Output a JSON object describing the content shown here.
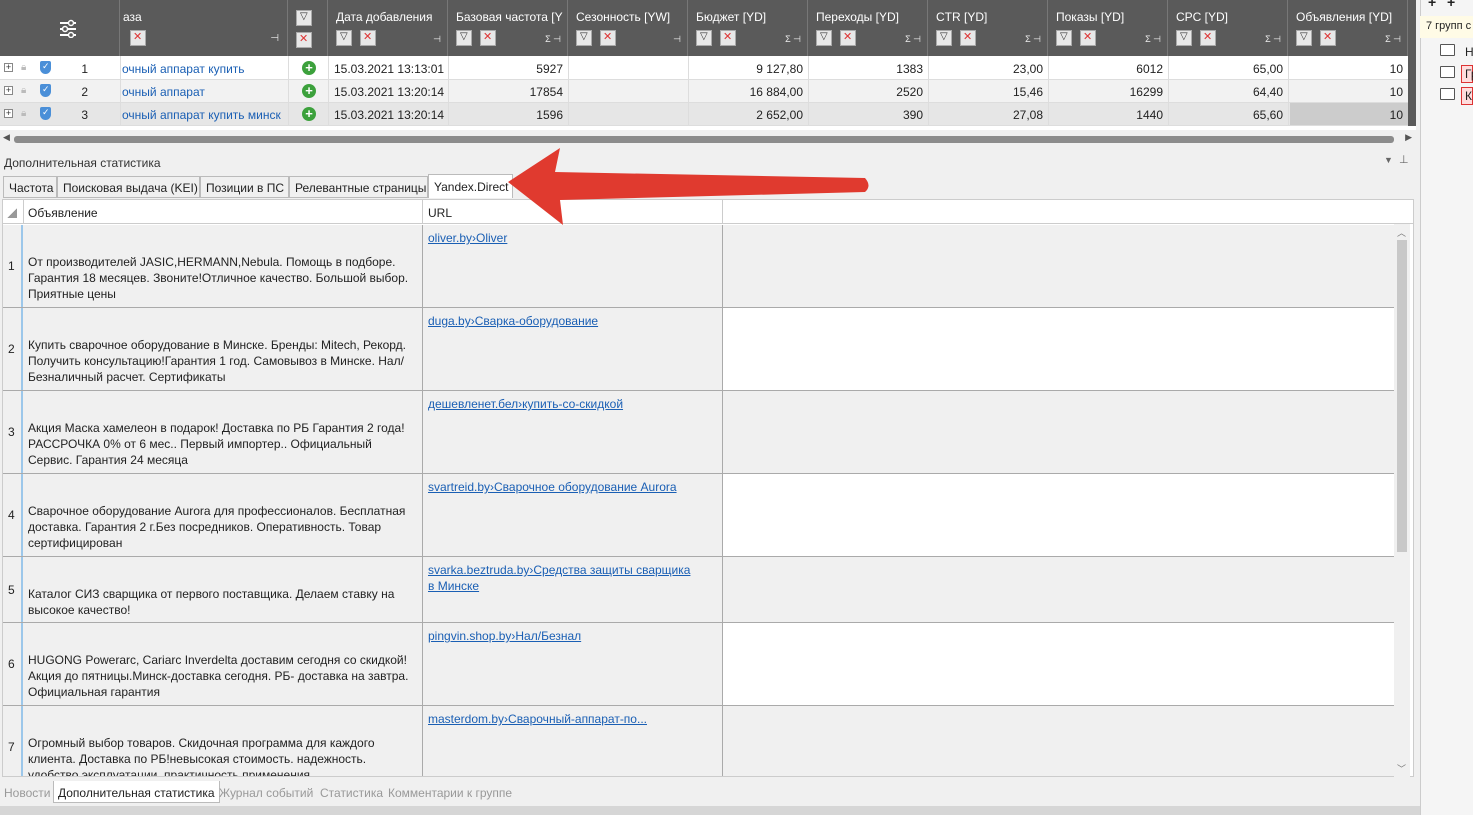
{
  "grid": {
    "headers": {
      "phrase": "аза",
      "date_added": "Дата добавления",
      "base_freq": "Базовая частота [Y",
      "season": "Сезонность [YW]",
      "budget": "Бюджет [YD]",
      "clicks": "Переходы [YD]",
      "ctr": "CTR [YD]",
      "shows": "Показы [YD]",
      "cpc": "CPC [YD]",
      "ads": "Объявления [YD]",
      "sigma": "Σ"
    },
    "rows": [
      {
        "num": "1",
        "phrase": "очный аппарат купить",
        "date": "15.03.2021 13:13:01",
        "base": "5927",
        "budget": "9 127,80",
        "clicks": "1383",
        "ctr": "23,00",
        "shows": "6012",
        "cpc": "65,00",
        "ads": "10"
      },
      {
        "num": "2",
        "phrase": "очный аппарат",
        "date": "15.03.2021 13:20:14",
        "base": "17854",
        "budget": "16 884,00",
        "clicks": "2520",
        "ctr": "15,46",
        "shows": "16299",
        "cpc": "64,40",
        "ads": "10"
      },
      {
        "num": "3",
        "phrase": "очный аппарат купить минск",
        "date": "15.03.2021 13:20:14",
        "base": "1596",
        "budget": "2 652,00",
        "clicks": "390",
        "ctr": "27,08",
        "shows": "1440",
        "cpc": "65,60",
        "ads": "10"
      }
    ]
  },
  "panel": {
    "title": "Дополнительная статистика",
    "tabs": [
      "Частота",
      "Поисковая выдача (KEI)",
      "Позиции в ПС",
      "Релевантные страницы",
      "Yandex.Direct"
    ],
    "active_tab": "Yandex.Direct"
  },
  "ads_table": {
    "col_ad": "Объявление",
    "col_url": "URL",
    "rows": [
      {
        "num": "1",
        "text": "От производителей JASIC,HERMANN,Nebula. Помощь в подборе. Гарантия 18 месяцев. Звоните!Отличное качество. Большой выбор. Приятные цены",
        "url": "oliver.by›Oliver"
      },
      {
        "num": "2",
        "text": "Купить сварочное оборудование в Минске. Бренды: Mitech, Рекорд. Получить консультацию!Гарантия 1 год. Самовывоз в Минске. Нал/Безналичный расчет. Сертификаты",
        "url": "duga.by›Сварка-оборудование"
      },
      {
        "num": "3",
        "text": "Акция Маска хамелеон в подарок! Доставка по РБ Гарантия 2 года! РАССРОЧКА 0% от 6 мес.. Первый импортер.. Официальный Сервис. Гарантия 24 месяца",
        "url": "дешевленет.бел›купить-со-скидкой"
      },
      {
        "num": "4",
        "text": "Сварочное оборудование Aurora для профессионалов. Бесплатная доставка. Гарантия 2 г.Без посредников. Оперативность. Товар сертифицирован",
        "url": "svartreid.by›Сварочное оборудование Aurora"
      },
      {
        "num": "5",
        "text": "Каталог СИЗ сварщика от первого поставщика. Делаем ставку на высокое качество!",
        "url": "svarka.beztruda.by›Средства защиты сварщика в Минске"
      },
      {
        "num": "6",
        "text": "HUGONG Powerarc, Cariarc Inverdelta доставим сегодня со скидкой! Акция до пятницы.Минск-доставка сегодня. РБ- доставка на завтра. Официальная гарантия",
        "url": "pingvin.shop.by›Нал/Безнал"
      },
      {
        "num": "7",
        "text": "Огромный выбор товаров. Скидочная программа для каждого клиента. Доставка по РБ!невысокая стоимость. надежность. удобство эксплуатации. практичность применения",
        "url": "masterdom.by›Сварочный-аппарат-по..."
      }
    ]
  },
  "bottom_tabs": [
    "Новости",
    "Дополнительная статистика",
    "Журнал событий",
    "Статистика",
    "Комментарии к группе"
  ],
  "sidebar": {
    "label": "7 групп с",
    "items": [
      "Н",
      "Гр",
      "К"
    ]
  },
  "colors": {
    "header_bg": "#5a5a5a",
    "link": "#1a5fb4",
    "arrow": "#e03a2f",
    "add_icon": "#3ca13c"
  }
}
